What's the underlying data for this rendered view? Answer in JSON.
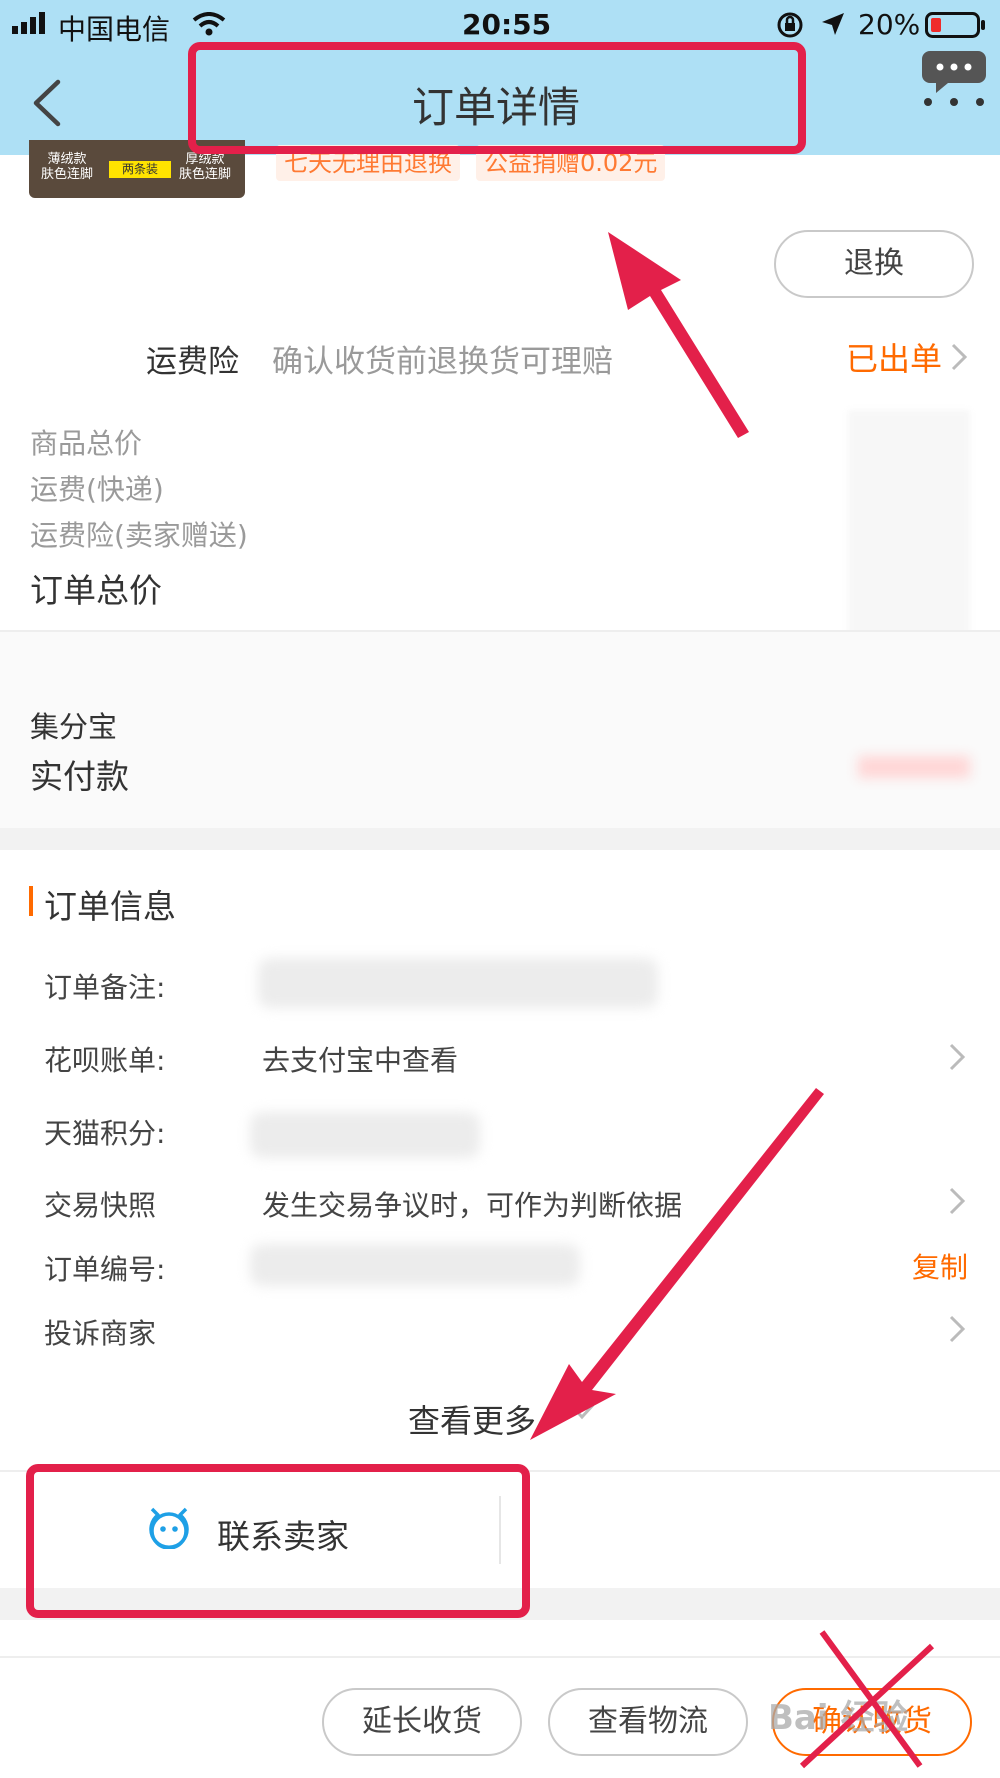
{
  "status_bar": {
    "carrier": "中国电信",
    "time": "20:55",
    "battery": "20%",
    "icons": [
      "signal-icon",
      "wifi-icon",
      "orientation-lock-icon",
      "location-icon",
      "battery-icon"
    ]
  },
  "nav": {
    "title": "订单详情",
    "back_icon": "chevron-left-icon",
    "more_icon": "chat-bubble-icon"
  },
  "product": {
    "thumb_left": "薄绒款\n肤色连脚",
    "thumb_badge": "两条装",
    "thumb_right": "厚绒款\n肤色连脚",
    "tag_return": "七天无理由退换",
    "tag_charity": "公益捐赠0.02元",
    "exchange_button": "退换"
  },
  "insurance": {
    "label": "运费险",
    "desc": "确认收货前退换货可理赔",
    "status": "已出单"
  },
  "price": {
    "goods_total": "商品总价",
    "shipping": "运费(快递)",
    "shipping_insurance": "运费险(卖家赠送)",
    "order_total": "订单总价",
    "jifenbao": "集分宝",
    "actual_paid": "实付款"
  },
  "order_info": {
    "section_title": "订单信息",
    "rows": [
      {
        "label": "订单备注:",
        "value": ""
      },
      {
        "label": "花呗账单:",
        "value": "去支付宝中查看"
      },
      {
        "label": "天猫积分:",
        "value": ""
      },
      {
        "label": "交易快照",
        "value": "发生交易争议时，可作为判断依据"
      },
      {
        "label": "订单编号:",
        "value": "",
        "action": "复制"
      },
      {
        "label": "投诉商家",
        "value": ""
      }
    ],
    "view_more": "查看更多"
  },
  "contact": {
    "label": "联系卖家"
  },
  "footer": {
    "extend_receipt": "延长收货",
    "view_logistics": "查看物流",
    "confirm_receipt": "确认收货",
    "watermark": "Bai 经验"
  },
  "colors": {
    "nav_bg": "#aee0f5",
    "accent_orange": "#ff6a00",
    "annotation_red": "#e3204a",
    "contact_blue": "#1ea0e6"
  }
}
